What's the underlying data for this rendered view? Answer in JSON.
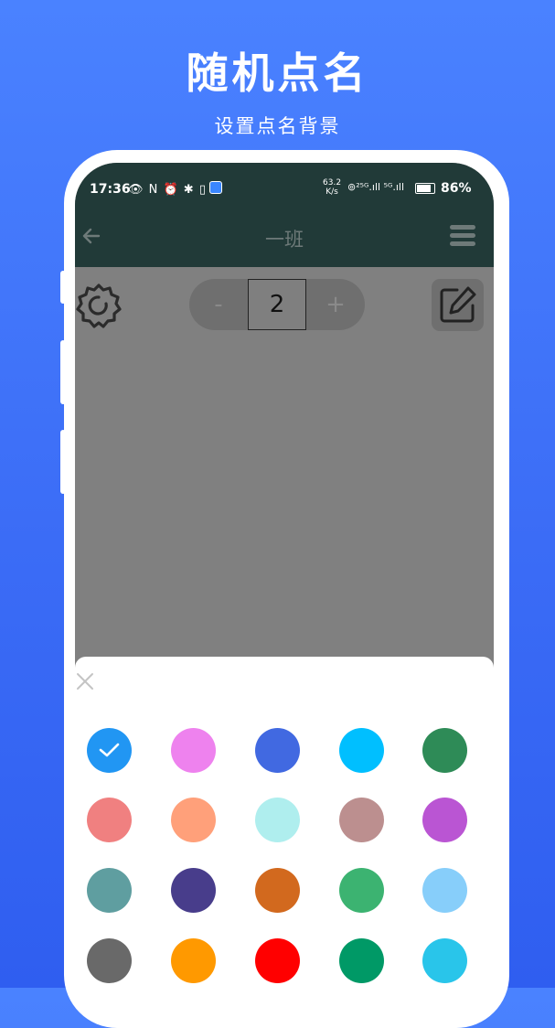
{
  "promo": {
    "title": "随机点名",
    "subtitle": "设置点名背景"
  },
  "statusbar": {
    "time": "17:36",
    "icons_text": "👁 N ⏰ ✱ ▯",
    "net_speed_value": "63.2",
    "net_speed_unit": "K/s",
    "signal_text": "⊚²⁵ᴳ.ıll ⁵ᴳ.ıll",
    "battery_percent": "86%",
    "battery_level": 0.86
  },
  "appbar": {
    "back_icon": "arrow-left-icon",
    "title": "一班",
    "menu_icon": "hamburger-menu-icon"
  },
  "toolbar": {
    "settings_icon": "gear-icon",
    "stepper": {
      "minus": "-",
      "value": "2",
      "plus": "+"
    },
    "edit_icon": "edit-icon"
  },
  "sheet": {
    "close_icon": "close-icon",
    "selected_index": 0,
    "colors": [
      "#2196f3",
      "#ee82ee",
      "#4169e1",
      "#00bfff",
      "#2e8b57",
      "#f08080",
      "#ffa07a",
      "#afeeee",
      "#bc8f8f",
      "#ba55d3",
      "#5f9ea0",
      "#483d8b",
      "#d2691e",
      "#3cb371",
      "#87cefa",
      "#696969",
      "#ff9900",
      "#ff0000",
      "#009966",
      "#29c5ea"
    ]
  }
}
